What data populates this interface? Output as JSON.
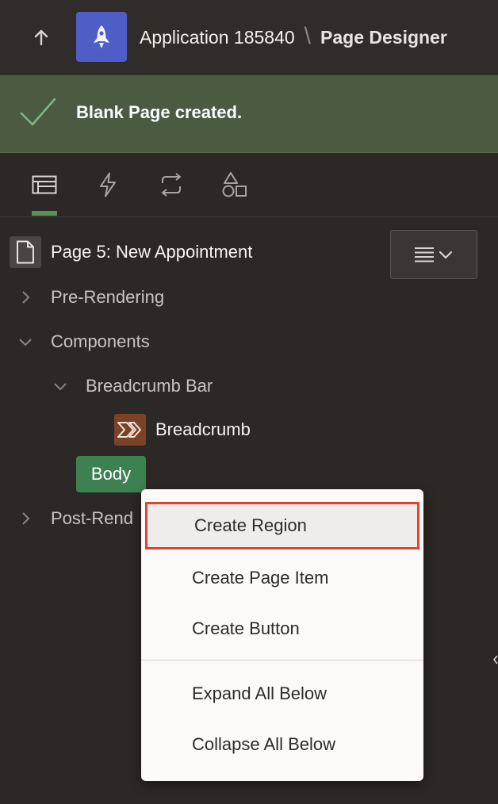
{
  "header": {
    "up_icon": "arrow-up-icon",
    "app_icon": "rocket-icon",
    "app_name": "Application 185840",
    "separator": "\\",
    "page_designer": "Page Designer"
  },
  "banner": {
    "icon": "checkmark-icon",
    "message": "Blank Page created."
  },
  "tabs": [
    {
      "name": "rendering",
      "icon": "rendering-tree-icon",
      "active": true
    },
    {
      "name": "dynamic-actions",
      "icon": "lightning-icon",
      "active": false
    },
    {
      "name": "processing",
      "icon": "process-arrows-icon",
      "active": false
    },
    {
      "name": "shared-components",
      "icon": "shapes-icon",
      "active": false
    }
  ],
  "tree": {
    "page_title": "Page 5: New Appointment",
    "menu_icon": "list-menu-icon",
    "nodes": {
      "pre_rendering": "Pre-Rendering",
      "components": "Components",
      "breadcrumb_bar": "Breadcrumb Bar",
      "breadcrumb": "Breadcrumb",
      "body": "Body",
      "post_rendering": "Post-Rend"
    }
  },
  "context_menu": {
    "items": [
      {
        "label": "Create Region",
        "focused": true
      },
      {
        "label": "Create Page Item"
      },
      {
        "label": "Create Button"
      },
      {
        "label": "Expand All Below"
      },
      {
        "label": "Collapse All Below"
      }
    ]
  },
  "colors": {
    "background": "#2b2826",
    "banner": "#4a5b42",
    "accent_green": "#3d8151",
    "app_icon": "#4f5ec7",
    "highlight_border": "#e0442d"
  }
}
